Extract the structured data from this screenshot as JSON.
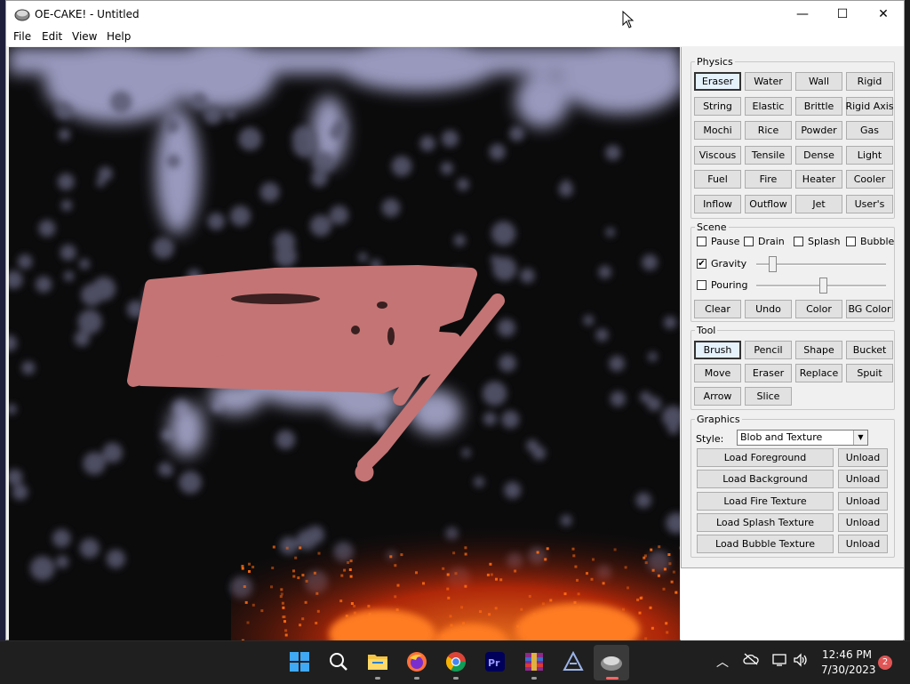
{
  "window": {
    "title": "OE-CAKE! - Untitled",
    "controls": {
      "minimize": "—",
      "maximize": "☐",
      "close": "✕"
    }
  },
  "menu": [
    "File",
    "Edit",
    "View",
    "Help"
  ],
  "physics": {
    "legend": "Physics",
    "buttons": [
      "Eraser",
      "Water",
      "Wall",
      "Rigid",
      "String",
      "Elastic",
      "Brittle",
      "Rigid Axis",
      "Mochi",
      "Rice",
      "Powder",
      "Gas",
      "Viscous",
      "Tensile",
      "Dense",
      "Light",
      "Fuel",
      "Fire",
      "Heater",
      "Cooler",
      "Inflow",
      "Outflow",
      "Jet",
      "User's"
    ],
    "selected": "Eraser"
  },
  "scene": {
    "legend": "Scene",
    "checks": [
      {
        "label": "Pause",
        "checked": false
      },
      {
        "label": "Drain",
        "checked": false
      },
      {
        "label": "Splash",
        "checked": false
      },
      {
        "label": "Bubble",
        "checked": false
      }
    ],
    "gravity": {
      "label": "Gravity",
      "checked": true,
      "slider_fraction": 0.1
    },
    "pouring": {
      "label": "Pouring",
      "checked": false,
      "slider_fraction": 0.52
    },
    "buttons": [
      "Clear",
      "Undo",
      "Color",
      "BG Color"
    ]
  },
  "tool": {
    "legend": "Tool",
    "buttons": [
      "Brush",
      "Pencil",
      "Shape",
      "Bucket",
      "Move",
      "Eraser",
      "Replace",
      "Spuit",
      "Arrow",
      "Slice"
    ],
    "selected": "Brush"
  },
  "graphics": {
    "legend": "Graphics",
    "style_label": "Style:",
    "style_value": "Blob and Texture",
    "loaders": [
      {
        "load": "Load Foreground",
        "unload": "Unload"
      },
      {
        "load": "Load Background",
        "unload": "Unload"
      },
      {
        "load": "Load Fire Texture",
        "unload": "Unload"
      },
      {
        "load": "Load Splash Texture",
        "unload": "Unload"
      },
      {
        "load": "Load Bubble Texture",
        "unload": "Unload"
      }
    ]
  },
  "taskbar": {
    "apps": [
      "start-icon",
      "search-icon",
      "file-explorer-icon",
      "firefox-icon",
      "chrome-icon",
      "premiere-icon",
      "winrar-icon",
      "app-a-icon",
      "oe-cake-icon"
    ],
    "time": "12:46 PM",
    "date": "7/30/2023",
    "notifications": "2"
  },
  "colors": {
    "accent_red": "#c87070",
    "water_lavender": "#b0b0d8",
    "fire_orange": "#ff5a10",
    "panel_bg": "#f0f0f0"
  }
}
